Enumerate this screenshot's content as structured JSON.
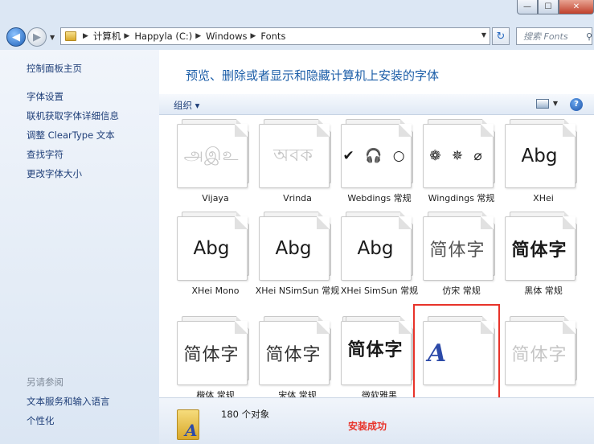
{
  "window": {
    "minimize": "—",
    "maximize": "☐",
    "close": "✕"
  },
  "address": {
    "path": [
      "计算机",
      "Happyla (C:)",
      "Windows",
      "Fonts"
    ]
  },
  "search": {
    "placeholder": "搜索 Fonts"
  },
  "sidebar": {
    "links": [
      "控制面板主页",
      "字体设置",
      "联机获取字体详细信息",
      "调整 ClearType 文本",
      "查找字符",
      "更改字体大小"
    ],
    "see_also_heading": "另请参阅",
    "see_also": [
      "文本服务和输入语言",
      "个性化"
    ]
  },
  "main": {
    "heading": "预览、删除或者显示和隐藏计算机上安装的字体",
    "organize": "组织 ▾",
    "help": "?"
  },
  "fonts": [
    {
      "label": "Vijaya",
      "sample": "அஇஉ",
      "faded": true
    },
    {
      "label": "Vrinda",
      "sample": "অবক",
      "faded": true
    },
    {
      "label": "Webdings 常规",
      "sample": "✔ 🎧 ○",
      "faded": false
    },
    {
      "label": "Wingdings 常规",
      "sample": "❁ ✵ ⌀",
      "faded": false
    },
    {
      "label": "XHei",
      "sample": "Abg",
      "faded": false
    },
    {
      "label": "XHei Mono",
      "sample": "Abg",
      "faded": false
    },
    {
      "label": "XHei NSimSun 常规",
      "sample": "Abg",
      "faded": false
    },
    {
      "label": "XHei SimSun 常规",
      "sample": "Abg",
      "faded": false
    },
    {
      "label": "仿宋 常规",
      "sample": "简体字",
      "faded": false
    },
    {
      "label": "黑体 常规",
      "sample": "简体字",
      "faded": false
    },
    {
      "label": "楷体 常规",
      "sample": "简体字",
      "faded": false
    },
    {
      "label": "宋体 常规",
      "sample": "简体字",
      "faded": false
    },
    {
      "label": "微软雅黑",
      "sample": "简体字",
      "faded": false
    },
    {
      "label": "",
      "sample": "A",
      "faded": false
    },
    {
      "label": "",
      "sample": "简体字",
      "faded": false
    }
  ],
  "status": {
    "count": "180 个对象",
    "message": "安装成功"
  },
  "colors": {
    "link": "#1e3e78",
    "heading": "#1c5ea8",
    "highlight": "#e8332a"
  }
}
